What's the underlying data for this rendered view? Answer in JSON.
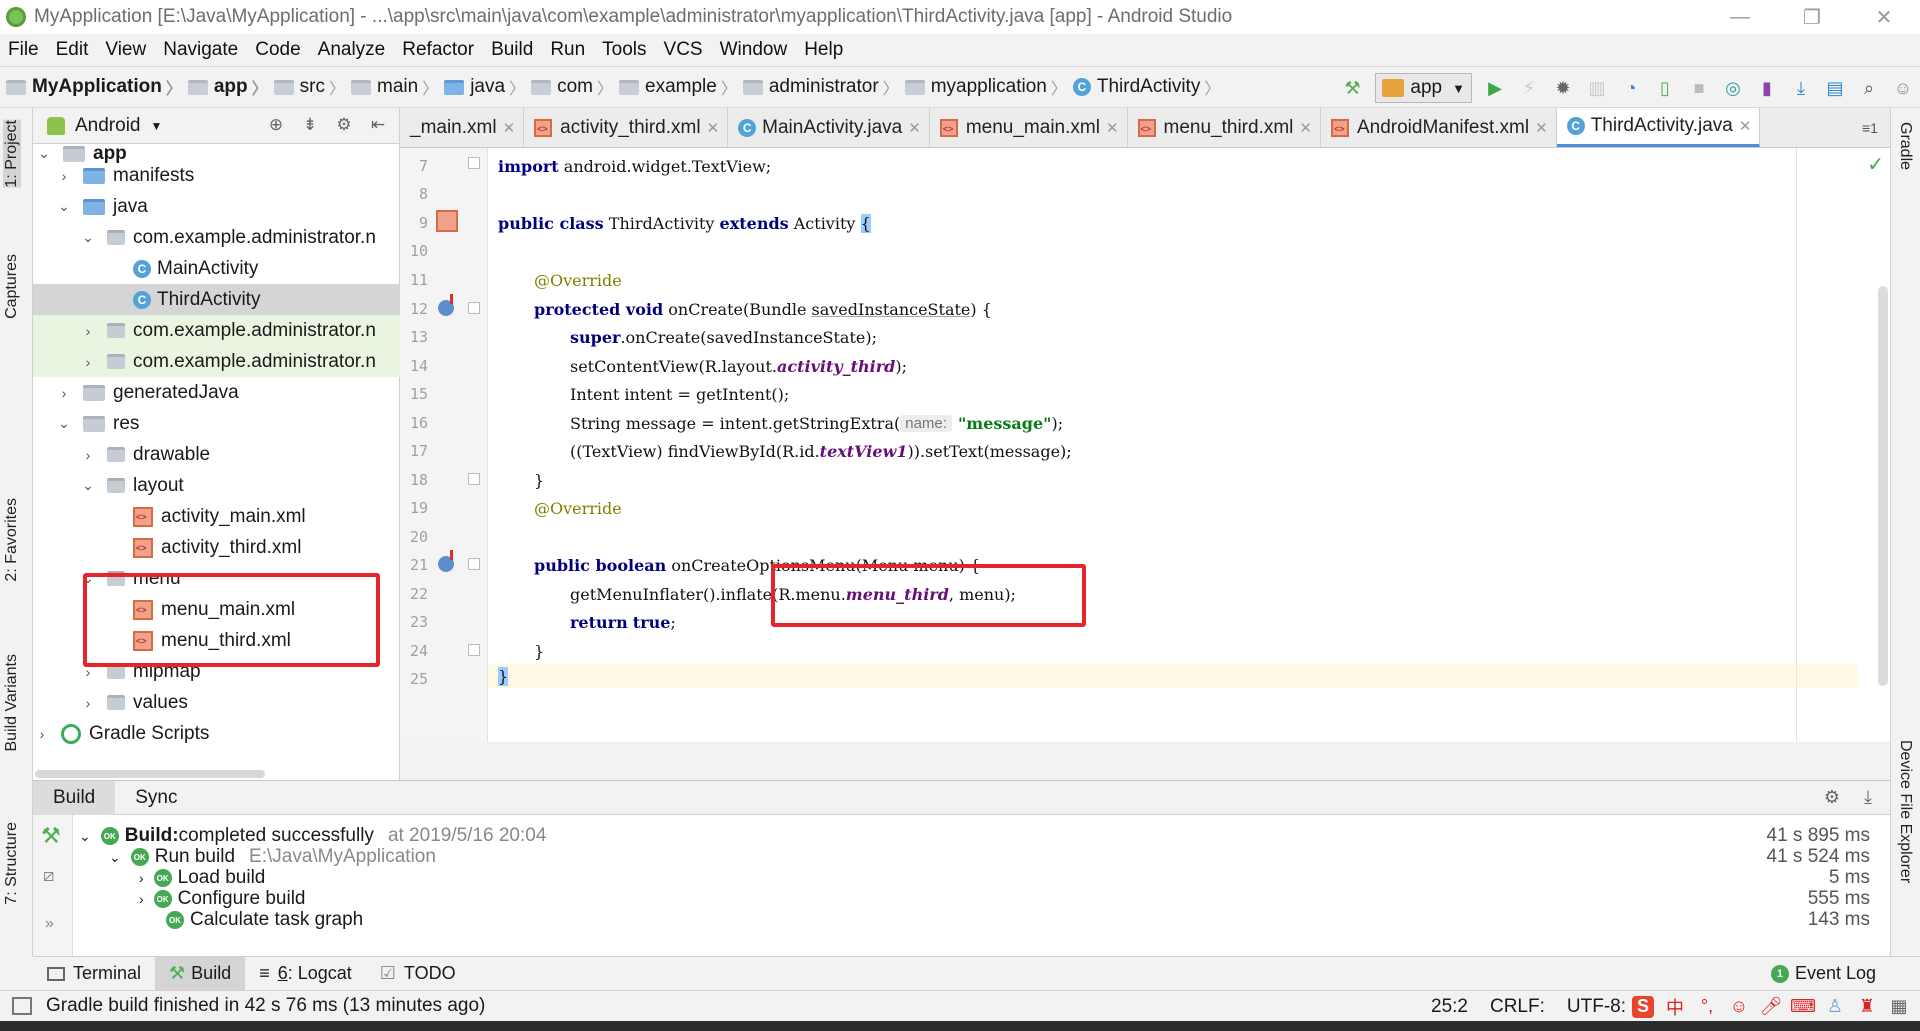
{
  "window": {
    "title": "MyApplication [E:\\Java\\MyApplication] - ...\\app\\src\\main\\java\\com\\example\\administrator\\myapplication\\ThirdActivity.java [app] - Android Studio",
    "minimize": "—",
    "restore": "❐",
    "close": "✕"
  },
  "menu": [
    "File",
    "Edit",
    "View",
    "Navigate",
    "Code",
    "Analyze",
    "Refactor",
    "Build",
    "Run",
    "Tools",
    "VCS",
    "Window",
    "Help"
  ],
  "breadcrumb": [
    "MyApplication",
    "app",
    "src",
    "main",
    "java",
    "com",
    "example",
    "administrator",
    "myapplication",
    "ThirdActivity"
  ],
  "run_config": "app",
  "left_strip": {
    "project": "1: Project",
    "captures": "Captures",
    "favorites": "2: Favorites",
    "build_variants": "Build Variants",
    "structure": "7: Structure"
  },
  "right_strip": {
    "gradle": "Gradle",
    "device_file_explorer": "Device File Explorer"
  },
  "project_panel": {
    "view": "Android",
    "tree": [
      {
        "label": "app",
        "arrow": "⌄"
      },
      {
        "label": "manifests",
        "arrow": "›"
      },
      {
        "label": "java",
        "arrow": "⌄"
      },
      {
        "label": "com.example.administrator.n",
        "arrow": "⌄"
      },
      {
        "label": "MainActivity",
        "arrow": ""
      },
      {
        "label": "ThirdActivity",
        "arrow": ""
      },
      {
        "label": "com.example.administrator.n",
        "arrow": "›"
      },
      {
        "label": "com.example.administrator.n",
        "arrow": "›"
      },
      {
        "label": "generatedJava",
        "arrow": "›"
      },
      {
        "label": "res",
        "arrow": "⌄"
      },
      {
        "label": "drawable",
        "arrow": "›"
      },
      {
        "label": "layout",
        "arrow": "⌄"
      },
      {
        "label": "activity_main.xml",
        "arrow": ""
      },
      {
        "label": "activity_third.xml",
        "arrow": ""
      },
      {
        "label": "menu",
        "arrow": "⌄"
      },
      {
        "label": "menu_main.xml",
        "arrow": ""
      },
      {
        "label": "menu_third.xml",
        "arrow": ""
      },
      {
        "label": "mipmap",
        "arrow": "›"
      },
      {
        "label": "values",
        "arrow": "›"
      },
      {
        "label": "Gradle Scripts",
        "arrow": "›"
      }
    ]
  },
  "tabs": [
    {
      "label": "_main.xml"
    },
    {
      "label": "activity_third.xml"
    },
    {
      "label": "MainActivity.java"
    },
    {
      "label": "menu_main.xml"
    },
    {
      "label": "menu_third.xml"
    },
    {
      "label": "AndroidManifest.xml"
    },
    {
      "label": "ThirdActivity.java"
    }
  ],
  "tabs_more": "≡1",
  "editor": {
    "line_numbers": [
      "7",
      "8",
      "9",
      "10",
      "11",
      "12",
      "13",
      "14",
      "15",
      "16",
      "17",
      "18",
      "19",
      "20",
      "21",
      "22",
      "23",
      "24",
      "25"
    ],
    "code": {
      "l7_kw": "import",
      "l7_rest": " android.widget.TextView;",
      "l9_kw1": "public class",
      "l9_name": " ThirdActivity ",
      "l9_kw2": "extends",
      "l9_rest": " Activity ",
      "l9_brace": "{",
      "l11": "@Override",
      "l12_kw": "protected void",
      "l12_rest": " onCreate(Bundle ",
      "l12_param": "savedInstanceState",
      "l12_end": ") {",
      "l13_kw": "super",
      "l13_rest": ".onCreate(savedInstanceState);",
      "l14_a": "setContentView(R.layout.",
      "l14_b": "activity_third",
      "l14_c": ");",
      "l15": "Intent intent = getIntent();",
      "l16_a": "String message = intent.getStringExtra(",
      "l16_hint": "name:",
      "l16_str": "\"message\"",
      "l16_c": ");",
      "l17_a": "((TextView) findViewById(R.id.",
      "l17_b": "textView1",
      "l17_c": ")).setText(message);",
      "l18": "}",
      "l19": "@Override",
      "l21_kw": "public boolean",
      "l21_rest": " onCreateOptionsMenu(Menu menu) {",
      "l22_a": "getMenuInflater().inflate(R.menu.",
      "l22_b": "menu_third",
      "l22_c": ", menu);",
      "l23_kw1": "return",
      "l23_kw2": "true",
      "l23_c": ";",
      "l24": "}",
      "l25": "}"
    }
  },
  "build": {
    "tab_build": "Build",
    "tab_sync": "Sync",
    "rows": {
      "r1_bold": "Build:",
      "r1_text": " completed successfully",
      "r1_time": "at 2019/5/16 20:04",
      "r1_dur": "41 s 895 ms",
      "r2_text": "Run build",
      "r2_path": "E:\\Java\\MyApplication",
      "r2_dur": "41 s 524 ms",
      "r3_text": "Load build",
      "r3_dur": "5 ms",
      "r4_text": "Configure build",
      "r4_dur": "555 ms",
      "r5_text": "Calculate task graph",
      "r5_dur": "143 ms"
    }
  },
  "bottom_tabs": {
    "terminal": "Terminal",
    "build": "Build",
    "logcat_num": "6",
    "logcat": ": Logcat",
    "todo": "TODO",
    "event_log": "Event Log",
    "event_count": "1"
  },
  "status": {
    "message": "Gradle build finished in 42 s 76 ms (13 minutes ago)",
    "position": "25:2",
    "line_sep": "CRLF:",
    "encoding": "UTF-8:",
    "ime_label": "中"
  },
  "colors": {
    "annotation_box": "#e5242b",
    "accent": "#4a8fd9"
  }
}
